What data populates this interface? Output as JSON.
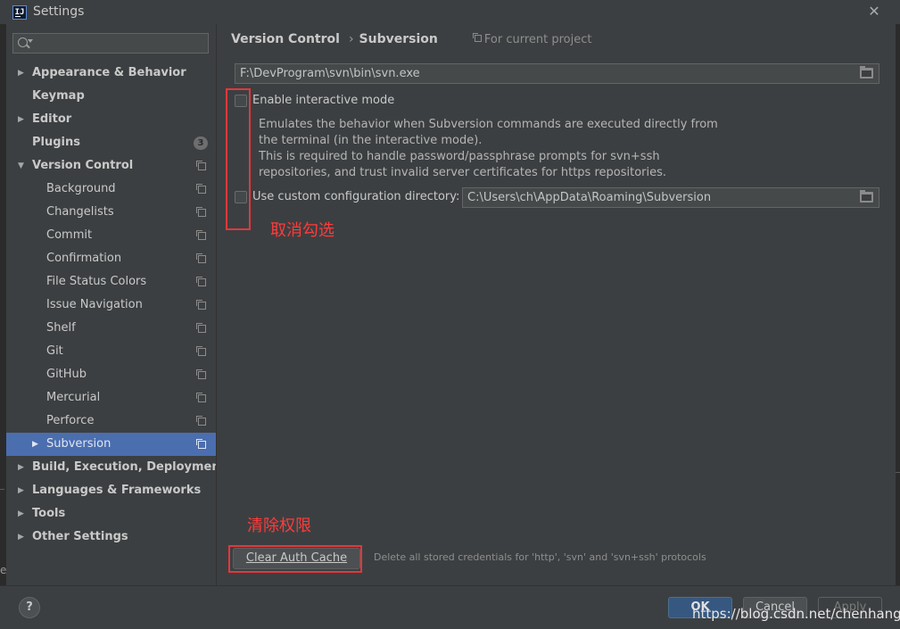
{
  "window": {
    "title": "Settings",
    "close_symbol": "✕",
    "app_icon_text": "IJ"
  },
  "search": {
    "value": "",
    "placeholder": ""
  },
  "sidebar": {
    "items": [
      {
        "label": "Appearance & Behavior",
        "arrow": "▶"
      },
      {
        "label": "Keymap",
        "arrow": ""
      },
      {
        "label": "Editor",
        "arrow": "▶"
      },
      {
        "label": "Plugins",
        "arrow": "",
        "badge": "3"
      },
      {
        "label": "Version Control",
        "arrow": "▼"
      },
      {
        "label": "Background"
      },
      {
        "label": "Changelists"
      },
      {
        "label": "Commit"
      },
      {
        "label": "Confirmation"
      },
      {
        "label": "File Status Colors"
      },
      {
        "label": "Issue Navigation"
      },
      {
        "label": "Shelf"
      },
      {
        "label": "Git"
      },
      {
        "label": "GitHub"
      },
      {
        "label": "Mercurial"
      },
      {
        "label": "Perforce"
      },
      {
        "label": "Subversion",
        "arrow": "▶"
      },
      {
        "label": "Build, Execution, Deployment",
        "arrow": "▶"
      },
      {
        "label": "Languages & Frameworks",
        "arrow": "▶"
      },
      {
        "label": "Tools",
        "arrow": "▶"
      },
      {
        "label": "Other Settings",
        "arrow": "▶"
      }
    ]
  },
  "breadcrumb": {
    "parent": "Version Control",
    "separator": "›",
    "current": "Subversion",
    "scope": "For current project"
  },
  "svn_path": {
    "value": "F:\\DevProgram\\svn\\bin\\svn.exe"
  },
  "interactive_mode": {
    "label": "Enable interactive mode",
    "checked": false,
    "description": [
      "Emulates the behavior when Subversion commands are executed directly from",
      "the terminal (in the interactive mode).",
      "This is required to handle password/passphrase prompts for svn+ssh",
      "repositories, and trust invalid server certificates for https repositories."
    ]
  },
  "custom_config": {
    "label": "Use custom configuration directory:",
    "checked": false,
    "value": "C:\\Users\\ch\\AppData\\Roaming\\Subversion"
  },
  "annotations": {
    "uncheck": "取消勾选",
    "clear_perm": "清除权限",
    "color": "#e0383e"
  },
  "clear_cache": {
    "button_label": "Clear Auth Cache",
    "description": "Delete all stored credentials for 'http', 'svn' and 'svn+ssh' protocols"
  },
  "footer": {
    "help_label": "?",
    "ok_label": "OK",
    "cancel_label": "Cancel",
    "apply_label": "Apply",
    "watermark": "https://blog.csdn.net/chenhangx"
  },
  "edge_text": "e",
  "colors": {
    "accent": "#4b6eaf",
    "background": "#3c3f41",
    "ok_button": "#365880"
  }
}
